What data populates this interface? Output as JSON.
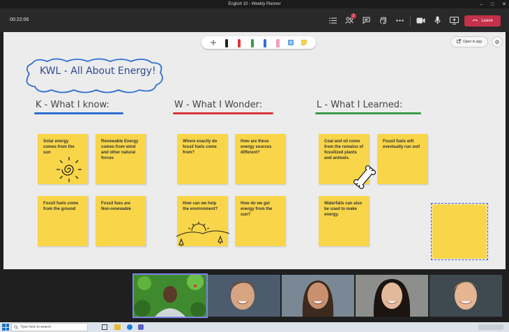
{
  "window": {
    "title": "English 10 - Weekly Planner"
  },
  "toolbar": {
    "timer": "00:22:06",
    "people_badge": "2",
    "leave_label": "Leave"
  },
  "whiteboard": {
    "open_in_app_label": "Open in app",
    "title": "KWL - All About Energy!",
    "columns": [
      {
        "heading": "K - What I know:",
        "underline_color": "#2f6fd0"
      },
      {
        "heading": "W - What I Wonder:",
        "underline_color": "#d9363e"
      },
      {
        "heading": "L - What I Learned:",
        "underline_color": "#3a9a4a"
      }
    ],
    "notes": [
      "Solar energy comes from the sun",
      "Renewable Energy comes from wind and other natural forces",
      "Fossil fuels come from the ground",
      "Fossil fues are Non-renewable",
      "Where exactly do fossil fuels come from?",
      "How are these energy sources different?",
      "How can we help the environment?",
      "How do we get energy from the sun?",
      "Coal and oil come from the remains of fossilized plants and animals.",
      "Fossil fuels will eventually run out!",
      "Waterfalls can also be used to make energy."
    ]
  },
  "taskbar": {
    "search_placeholder": "Type here to search"
  },
  "colors": {
    "note": "#f9d649",
    "leave": "#c4314b",
    "accent": "#7b83eb"
  },
  "icons": [
    "list-icon",
    "people-icon",
    "chat-icon",
    "raise-hand-icon",
    "more-icon",
    "camera-icon",
    "mic-icon",
    "share-icon",
    "phone-icon",
    "gear-icon",
    "search-icon",
    "windows-logo-icon"
  ]
}
